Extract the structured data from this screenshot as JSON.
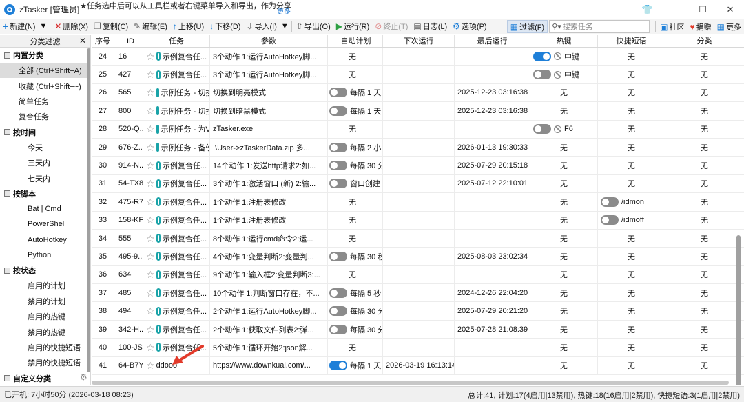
{
  "app": {
    "title": "zTasker [管理员]",
    "notice": "★任务选中后可以从工具栏或者右键菜单导入和导出，作为分享",
    "more": "更多"
  },
  "toolbar": {
    "new": "新建(N)",
    "new_arrow": "▼",
    "delete": "删除(X)",
    "copy": "复制(C)",
    "edit": "编辑(E)",
    "up": "上移(U)",
    "down": "下移(D)",
    "import": "导入(I)",
    "import_arrow": "▼",
    "export": "导出(O)",
    "run": "运行(R)",
    "stop": "终止(T)",
    "log": "日志(L)",
    "options": "选项(P)",
    "filter": "过滤(F)",
    "search_placeholder": "搜索任务",
    "community": "社区",
    "donate": "捐赠",
    "more": "更多"
  },
  "sidebar": {
    "header": "分类过滤",
    "groups": [
      {
        "label": "内置分类",
        "items": [
          {
            "label": "全部 (Ctrl+Shift+A)",
            "level": 1,
            "active": true
          },
          {
            "label": "收藏 (Ctrl+Shift+~)",
            "level": 1
          },
          {
            "label": "简单任务",
            "level": 1
          },
          {
            "label": "复合任务",
            "level": 1
          }
        ]
      },
      {
        "label": "按时间",
        "items": [
          {
            "label": "今天",
            "level": 2
          },
          {
            "label": "三天内",
            "level": 2
          },
          {
            "label": "七天内",
            "level": 2
          }
        ]
      },
      {
        "label": "按脚本",
        "items": [
          {
            "label": "Bat | Cmd",
            "level": 2
          },
          {
            "label": "PowerShell",
            "level": 2
          },
          {
            "label": "AutoHotkey",
            "level": 2
          },
          {
            "label": "Python",
            "level": 2
          }
        ]
      },
      {
        "label": "按状态",
        "items": [
          {
            "label": "启用的计划",
            "level": 2
          },
          {
            "label": "禁用的计划",
            "level": 2
          },
          {
            "label": "启用的热键",
            "level": 2
          },
          {
            "label": "禁用的热键",
            "level": 2
          },
          {
            "label": "启用的快捷短语",
            "level": 2
          },
          {
            "label": "禁用的快捷短语",
            "level": 2
          }
        ]
      },
      {
        "label": "自定义分类",
        "items": []
      }
    ]
  },
  "table": {
    "columns": [
      "序号",
      "ID",
      "任务",
      "参数",
      "自动计划",
      "下次运行",
      "最后运行",
      "热键",
      "快捷短语",
      "分类"
    ],
    "rows": [
      {
        "seq": "24",
        "id": "16",
        "task": "示例复合任...",
        "param": "3个动作 1:运行AutoHotkey脚...",
        "auto": "无",
        "auto_toggle": "none",
        "next": "",
        "last": "",
        "hot": "中键",
        "hot_toggle": "on",
        "phrase": "无",
        "phrase_toggle": "none",
        "cat": "无"
      },
      {
        "seq": "25",
        "id": "427",
        "task": "示例复合任...",
        "param": "3个动作 1:运行AutoHotkey脚...",
        "auto": "无",
        "auto_toggle": "none",
        "next": "",
        "last": "",
        "hot": "中键",
        "hot_toggle": "off",
        "phrase": "无",
        "phrase_toggle": "none",
        "cat": "无"
      },
      {
        "seq": "26",
        "id": "565",
        "task": "示例任务 - 切换...",
        "param": "切换到明亮模式",
        "auto": "每隔 1 天",
        "auto_toggle": "off",
        "next": "",
        "last": "2025-12-23 03:16:38",
        "hot": "无",
        "hot_toggle": "none",
        "phrase": "无",
        "phrase_toggle": "none",
        "cat": "无"
      },
      {
        "seq": "27",
        "id": "800",
        "task": "示例任务 - 切换...",
        "param": "切换到暗黑模式",
        "auto": "每隔 1 天",
        "auto_toggle": "off",
        "next": "",
        "last": "2025-12-23 03:16:38",
        "hot": "无",
        "hot_toggle": "none",
        "phrase": "无",
        "phrase_toggle": "none",
        "cat": "无"
      },
      {
        "seq": "28",
        "id": "520-Q...",
        "task": "示例任务 - 为V...",
        "param": "zTasker.exe",
        "auto": "无",
        "auto_toggle": "none",
        "next": "",
        "last": "",
        "hot": "F6",
        "hot_toggle": "off",
        "phrase": "无",
        "phrase_toggle": "none",
        "cat": "无"
      },
      {
        "seq": "29",
        "id": "676-Z...",
        "task": "示例任务 - 备份...",
        "param": ".\\User->zTaskerData.zip 多...",
        "auto": "每隔 2 小时",
        "auto_toggle": "off",
        "next": "",
        "last": "2026-01-13 19:30:33",
        "hot": "无",
        "hot_toggle": "none",
        "phrase": "无",
        "phrase_toggle": "none",
        "cat": "无"
      },
      {
        "seq": "30",
        "id": "914-N...",
        "task": "示例复合任...",
        "param": "14个动作 1:发送http请求2:如...",
        "auto": "每隔 30 分钟",
        "auto_toggle": "off",
        "next": "",
        "last": "2025-07-29 20:15:18",
        "hot": "无",
        "hot_toggle": "none",
        "phrase": "无",
        "phrase_toggle": "none",
        "cat": "无"
      },
      {
        "seq": "31",
        "id": "54-TX8...",
        "task": "示例复合任...",
        "param": "3个动作 1:激活窗口 (新) 2:输...",
        "auto": "窗口创建 标题:...",
        "auto_toggle": "off",
        "next": "",
        "last": "2025-07-12 22:10:01",
        "hot": "无",
        "hot_toggle": "none",
        "phrase": "无",
        "phrase_toggle": "none",
        "cat": "无"
      },
      {
        "seq": "32",
        "id": "475-R7...",
        "task": "示例复合任...",
        "param": "1个动作 1:注册表修改",
        "auto": "无",
        "auto_toggle": "none",
        "next": "",
        "last": "",
        "hot": "无",
        "hot_toggle": "none",
        "phrase": "/idmon",
        "phrase_toggle": "off",
        "cat": "无"
      },
      {
        "seq": "33",
        "id": "158-KF...",
        "task": "示例复合任...",
        "param": "1个动作 1:注册表修改",
        "auto": "无",
        "auto_toggle": "none",
        "next": "",
        "last": "",
        "hot": "无",
        "hot_toggle": "none",
        "phrase": "/idmoff",
        "phrase_toggle": "off",
        "cat": "无"
      },
      {
        "seq": "34",
        "id": "555",
        "task": "示例复合任...",
        "param": "8个动作 1:运行cmd命令2:运...",
        "auto": "无",
        "auto_toggle": "none",
        "next": "",
        "last": "",
        "hot": "无",
        "hot_toggle": "none",
        "phrase": "无",
        "phrase_toggle": "none",
        "cat": "无"
      },
      {
        "seq": "35",
        "id": "495-9...",
        "task": "示例复合任...",
        "param": "4个动作 1:变量判断2:变量判...",
        "auto": "每隔 30 秒",
        "auto_toggle": "off",
        "next": "",
        "last": "2025-08-03 23:02:34",
        "hot": "无",
        "hot_toggle": "none",
        "phrase": "无",
        "phrase_toggle": "none",
        "cat": "无"
      },
      {
        "seq": "36",
        "id": "634",
        "task": "示例复合任...",
        "param": "9个动作 1:输入框2:变量判断3:...",
        "auto": "无",
        "auto_toggle": "none",
        "next": "",
        "last": "",
        "hot": "无",
        "hot_toggle": "none",
        "phrase": "无",
        "phrase_toggle": "none",
        "cat": "无"
      },
      {
        "seq": "37",
        "id": "485",
        "task": "示例复合任...",
        "param": "10个动作 1:判断窗口存在，不...",
        "auto": "每隔 5 秒",
        "auto_toggle": "off",
        "next": "",
        "last": "2024-12-26 22:04:20",
        "hot": "无",
        "hot_toggle": "none",
        "phrase": "无",
        "phrase_toggle": "none",
        "cat": "无"
      },
      {
        "seq": "38",
        "id": "494",
        "task": "示例复合任...",
        "param": "2个动作 1:运行AutoHotkey脚...",
        "auto": "每隔 30 分钟",
        "auto_toggle": "off",
        "next": "",
        "last": "2025-07-29 20:21:20",
        "hot": "无",
        "hot_toggle": "none",
        "phrase": "无",
        "phrase_toggle": "none",
        "cat": "无"
      },
      {
        "seq": "39",
        "id": "342-H...",
        "task": "示例复合任...",
        "param": "2个动作 1:获取文件列表2:弹...",
        "auto": "每隔 30 分钟",
        "auto_toggle": "off",
        "next": "",
        "last": "2025-07-28 21:08:39",
        "hot": "无",
        "hot_toggle": "none",
        "phrase": "无",
        "phrase_toggle": "none",
        "cat": "无"
      },
      {
        "seq": "40",
        "id": "100-JS...",
        "task": "示例复合任...",
        "param": "5个动作 1:循环开始2:json解...",
        "auto": "无",
        "auto_toggle": "none",
        "next": "",
        "last": "",
        "hot": "无",
        "hot_toggle": "none",
        "phrase": "无",
        "phrase_toggle": "none",
        "cat": "无"
      },
      {
        "seq": "41",
        "id": "64-B7Y...",
        "task": "ddooo",
        "param": "https://www.downkuai.com/...",
        "auto": "每隔 1 天",
        "auto_toggle": "on",
        "next": "2026-03-19 16:13:14...",
        "last": "",
        "hot": "无",
        "hot_toggle": "none",
        "phrase": "无",
        "phrase_toggle": "none",
        "cat": "无",
        "simple": true
      }
    ]
  },
  "status": {
    "left": "已开机: 7小时50分 (2026-03-18 08:23)",
    "right": "总计:41, 计划:17(4启用|13禁用), 热键:18(16启用|2禁用), 快捷短语:3(1启用|2禁用)"
  },
  "colors": {
    "accent": "#1e7fd8",
    "task_icon": "#1aa3a8",
    "arrow": "#e23a2a"
  }
}
